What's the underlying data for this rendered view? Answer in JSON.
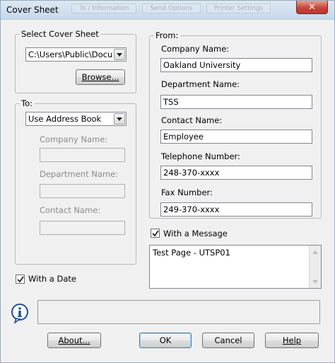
{
  "window": {
    "title": "Cover Sheet",
    "close_glyph": "✕",
    "background_tabs": [
      "To / Information",
      "Send Options",
      "Printer Settings"
    ]
  },
  "select_cover_sheet": {
    "legend": "Select Cover Sheet",
    "path_value": "C:\\Users\\Public\\Docum",
    "browse_label": "Browse..."
  },
  "to": {
    "legend": "To:",
    "source_value": "Use Address Book",
    "company_label": "Company Name:",
    "company_value": "",
    "department_label": "Department Name:",
    "department_value": "",
    "contact_label": "Contact Name:",
    "contact_value": ""
  },
  "from": {
    "legend": "From:",
    "company_label": "Company Name:",
    "company_value": "Oakland University",
    "department_label": "Department Name:",
    "department_value": "TSS",
    "contact_label": "Contact Name:",
    "contact_value": "Employee",
    "telephone_label": "Telephone Number:",
    "telephone_value": "248-370-xxxx",
    "fax_label": "Fax Number:",
    "fax_value": "249-370-xxxx"
  },
  "message": {
    "checkbox_label": "With a Message",
    "checked": true,
    "text": "Test Page - UTSP01"
  },
  "date": {
    "checkbox_label": "With a Date",
    "checked": true
  },
  "status": {
    "text": ""
  },
  "buttons": {
    "about": "About...",
    "ok": "OK",
    "cancel": "Cancel",
    "help": "Help"
  },
  "colors": {
    "accent": "#3c7fb1",
    "close": "#c8443a",
    "info_icon": "#1f4f9e"
  },
  "icons": {
    "info": "info-icon",
    "close": "close-icon",
    "check": "check-icon",
    "dropdown": "chevron-down-icon"
  }
}
